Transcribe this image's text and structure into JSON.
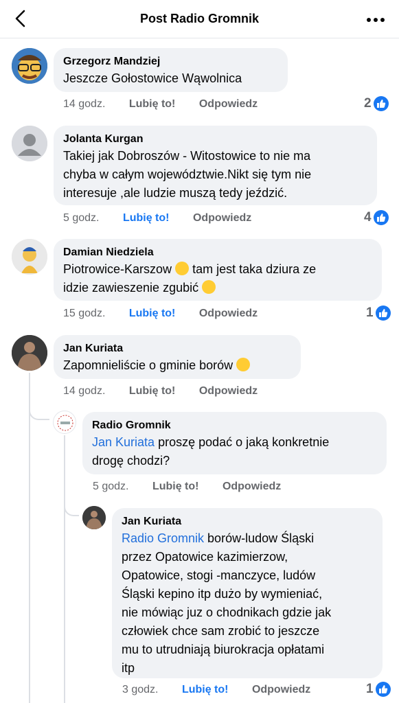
{
  "header": {
    "title": "Post Radio Gromnik"
  },
  "comments": [
    {
      "author": "Grzegorz Mandziej",
      "lines": [
        "Jeszcze Gołostowice Wąwolnica"
      ],
      "time": "14 godz.",
      "like": "Lubię to!",
      "reply": "Odpowiedz",
      "likes": "2"
    },
    {
      "author": "Jolanta Kurgan",
      "lines": [
        "Takiej jak Dobroszów - Witostowice  to nie ma",
        "chyba w całym województwie.Nikt się tym nie",
        "interesuje ,ale ludzie muszą tedy jeździć."
      ],
      "time": "5 godz.",
      "like": "Lubię to!",
      "reply": "Odpowiedz",
      "likes": "4"
    },
    {
      "author": "Damian Niedziela",
      "line1": "Piotrowice-Karszow",
      "line1b": "tam jest taka dziura ze",
      "line2": "idzie zawieszenie zgubić",
      "time": "15 godz.",
      "like": "Lubię to!",
      "reply": "Odpowiedz",
      "likes": "1"
    },
    {
      "author": "Jan Kuriata",
      "line1": "Zapomnieliście o gminie borów",
      "time": "14 godz.",
      "like": "Lubię to!",
      "reply": "Odpowiedz"
    },
    {
      "author": "Radio Gromnik",
      "mention": "Jan Kuriata",
      "line1": " proszę podać o jaką konkretnie",
      "line2": "drogę chodzi?",
      "time": "5 godz.",
      "like": "Lubię to!",
      "reply": "Odpowiedz"
    },
    {
      "author": "Jan Kuriata",
      "mention": "Radio Gromnik",
      "line1": " borów-ludow Śląski",
      "lines": [
        "przez Opatowice kazimierzow,",
        "Opatowice, stogi -manczyce, ludów",
        "Śląski kepino itp dużo by wymieniać,",
        "nie mówiąc juz o chodnikach gdzie jak",
        "człowiek chce sam zrobić to jeszcze",
        "mu to utrudniają biurokracja opłatami",
        "itp"
      ],
      "time": "3 godz.",
      "like": "Lubię to!",
      "reply": "Odpowiedz",
      "likes": "1"
    }
  ],
  "colors": {
    "accent": "#1877f2",
    "bubble": "#f0f2f5",
    "mention": "#216fdb",
    "meta": "#65676b"
  },
  "icons": {
    "back": "chevron-left-icon",
    "more": "more-dots-icon",
    "like": "thumbs-up-icon"
  }
}
